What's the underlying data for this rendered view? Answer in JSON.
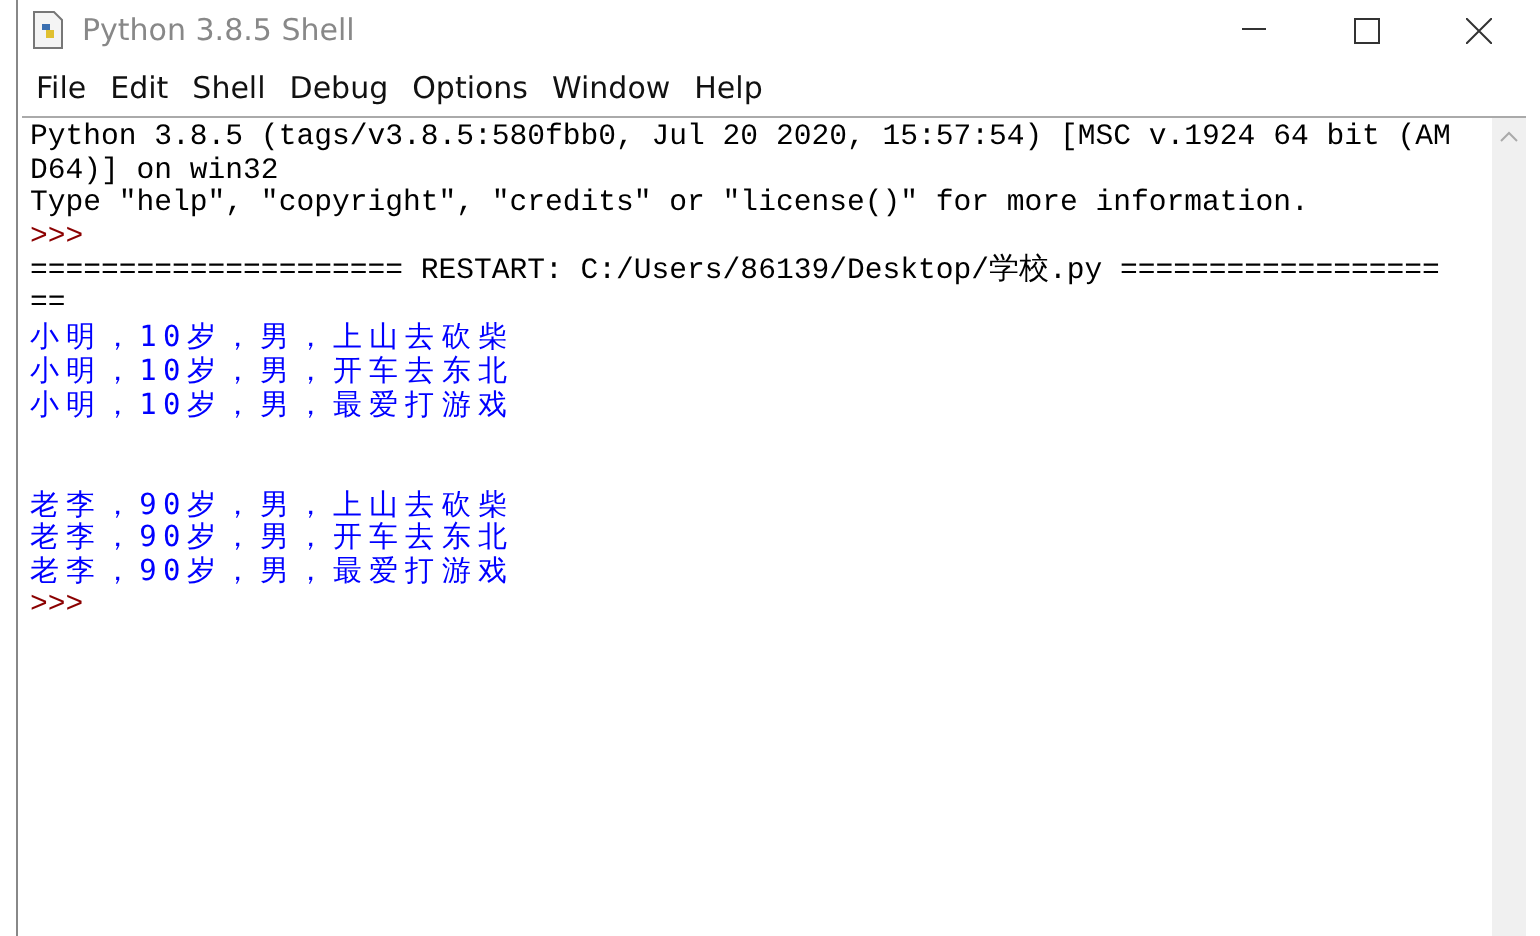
{
  "window": {
    "title": "Python 3.8.5 Shell"
  },
  "menu": [
    "File",
    "Edit",
    "Shell",
    "Debug",
    "Options",
    "Window",
    "Help"
  ],
  "lines": [
    {
      "kind": "text",
      "text": "Python 3.8.5 (tags/v3.8.5:580fbb0, Jul 20 2020, 15:57:54) [MSC v.1924 64 bit (AM"
    },
    {
      "kind": "text",
      "text": "D64)] on win32"
    },
    {
      "kind": "text",
      "text": "Type \"help\", \"copyright\", \"credits\" or \"license()\" for more information."
    },
    {
      "kind": "prompt",
      "text": ">>>"
    },
    {
      "kind": "text",
      "text": "===================== RESTART: C:/Users/86139/Desktop/学校.py =================="
    },
    {
      "kind": "text",
      "text": "=="
    },
    {
      "kind": "output",
      "text": "小明，10岁，男，上山去砍柴"
    },
    {
      "kind": "output",
      "text": "小明，10岁，男，开车去东北"
    },
    {
      "kind": "output",
      "text": "小明，10岁，男，最爱打游戏"
    },
    {
      "kind": "blank"
    },
    {
      "kind": "blank"
    },
    {
      "kind": "output",
      "text": "老李，90岁，男，上山去砍柴"
    },
    {
      "kind": "output",
      "text": "老李，90岁，男，开车去东北"
    },
    {
      "kind": "output",
      "text": "老李，90岁，男，最爱打游戏"
    },
    {
      "kind": "prompt",
      "text": ">>>"
    }
  ]
}
